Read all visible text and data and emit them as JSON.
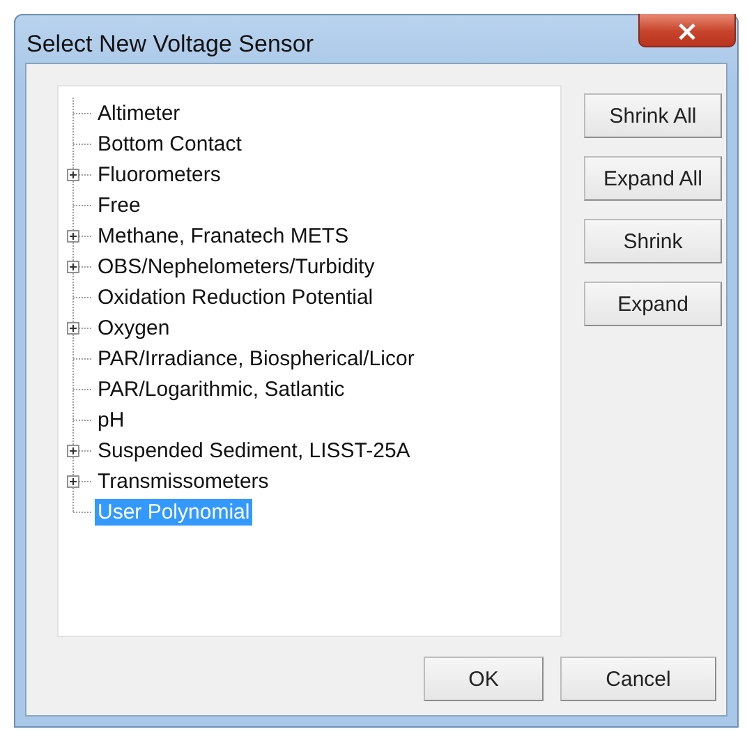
{
  "window": {
    "title": "Select New Voltage Sensor",
    "close": "×"
  },
  "tree": {
    "items": [
      {
        "label": "Altimeter",
        "expandable": false,
        "selected": false
      },
      {
        "label": "Bottom Contact",
        "expandable": false,
        "selected": false
      },
      {
        "label": "Fluorometers",
        "expandable": true,
        "selected": false
      },
      {
        "label": "Free",
        "expandable": false,
        "selected": false
      },
      {
        "label": "Methane, Franatech METS",
        "expandable": true,
        "selected": false
      },
      {
        "label": "OBS/Nephelometers/Turbidity",
        "expandable": true,
        "selected": false
      },
      {
        "label": "Oxidation Reduction Potential",
        "expandable": false,
        "selected": false
      },
      {
        "label": "Oxygen",
        "expandable": true,
        "selected": false
      },
      {
        "label": "PAR/Irradiance, Biospherical/Licor",
        "expandable": false,
        "selected": false
      },
      {
        "label": "PAR/Logarithmic, Satlantic",
        "expandable": false,
        "selected": false
      },
      {
        "label": "pH",
        "expandable": false,
        "selected": false
      },
      {
        "label": "Suspended Sediment, LISST-25A",
        "expandable": true,
        "selected": false
      },
      {
        "label": "Transmissometers",
        "expandable": true,
        "selected": false
      },
      {
        "label": "User Polynomial",
        "expandable": false,
        "selected": true
      }
    ]
  },
  "side_buttons": [
    "Shrink All",
    "Expand All",
    "Shrink",
    "Expand"
  ],
  "buttons": [
    "OK",
    "Cancel"
  ]
}
